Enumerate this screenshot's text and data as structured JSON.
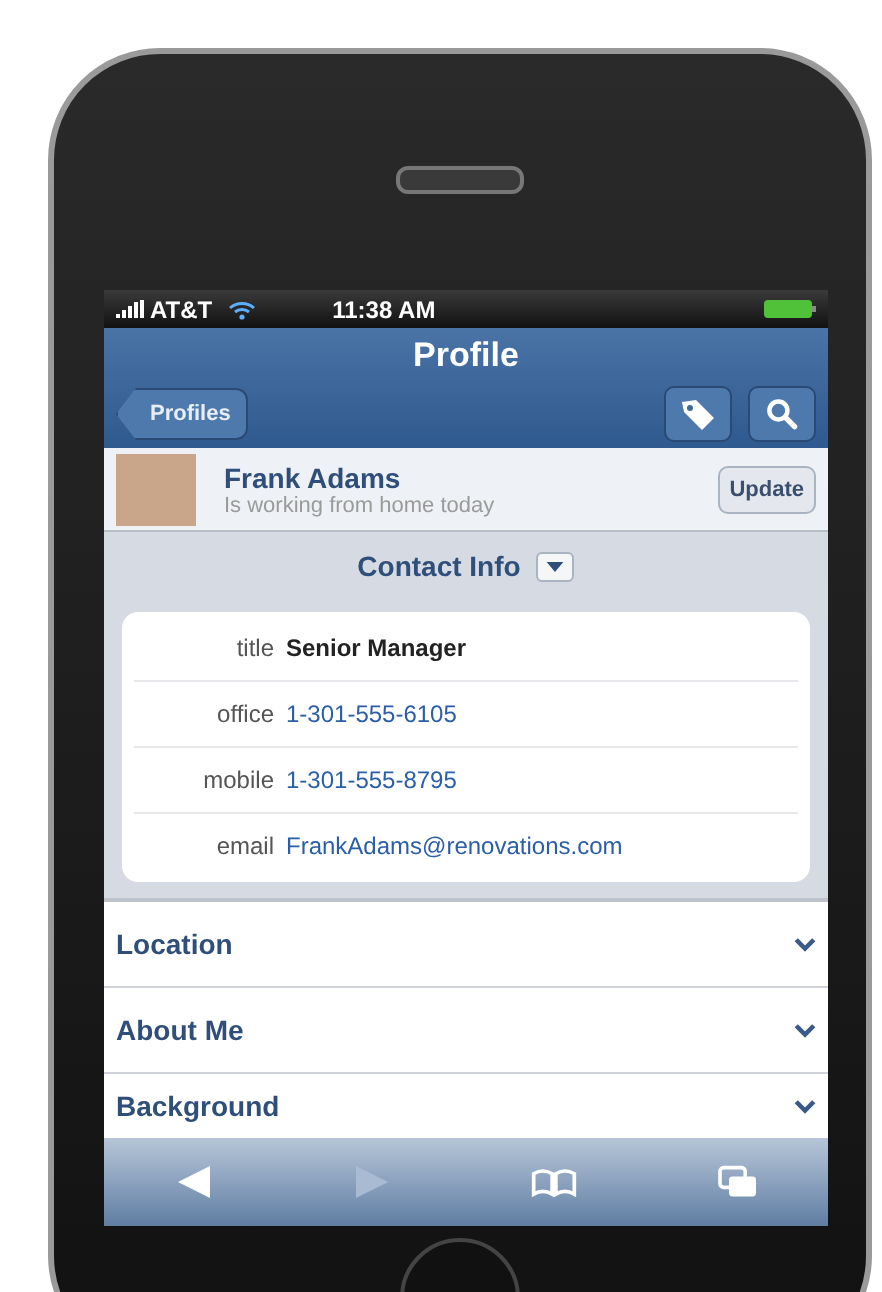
{
  "status_bar": {
    "carrier": "AT&T",
    "time": "11:38 AM"
  },
  "nav_bar": {
    "title": "Profile",
    "back_button": "Profiles"
  },
  "profile": {
    "name": "Frank Adams",
    "status": "Is working from home today",
    "update_button": "Update"
  },
  "contact_info": {
    "title": "Contact Info",
    "fields": [
      {
        "label": "title",
        "value": "Senior Manager",
        "kind": "text"
      },
      {
        "label": "office",
        "value": "1-301-555-6105",
        "kind": "link"
      },
      {
        "label": "mobile",
        "value": "1-301-555-8795",
        "kind": "link"
      },
      {
        "label": "email",
        "value": "FrankAdams@renovations.com",
        "kind": "link"
      }
    ]
  },
  "sections": [
    {
      "title": "Location"
    },
    {
      "title": "About Me"
    },
    {
      "title": "Background"
    }
  ],
  "toolbar": [
    {
      "disabled": false
    },
    {
      "disabled": true
    },
    {
      "disabled": false
    },
    {
      "disabled": false
    }
  ]
}
